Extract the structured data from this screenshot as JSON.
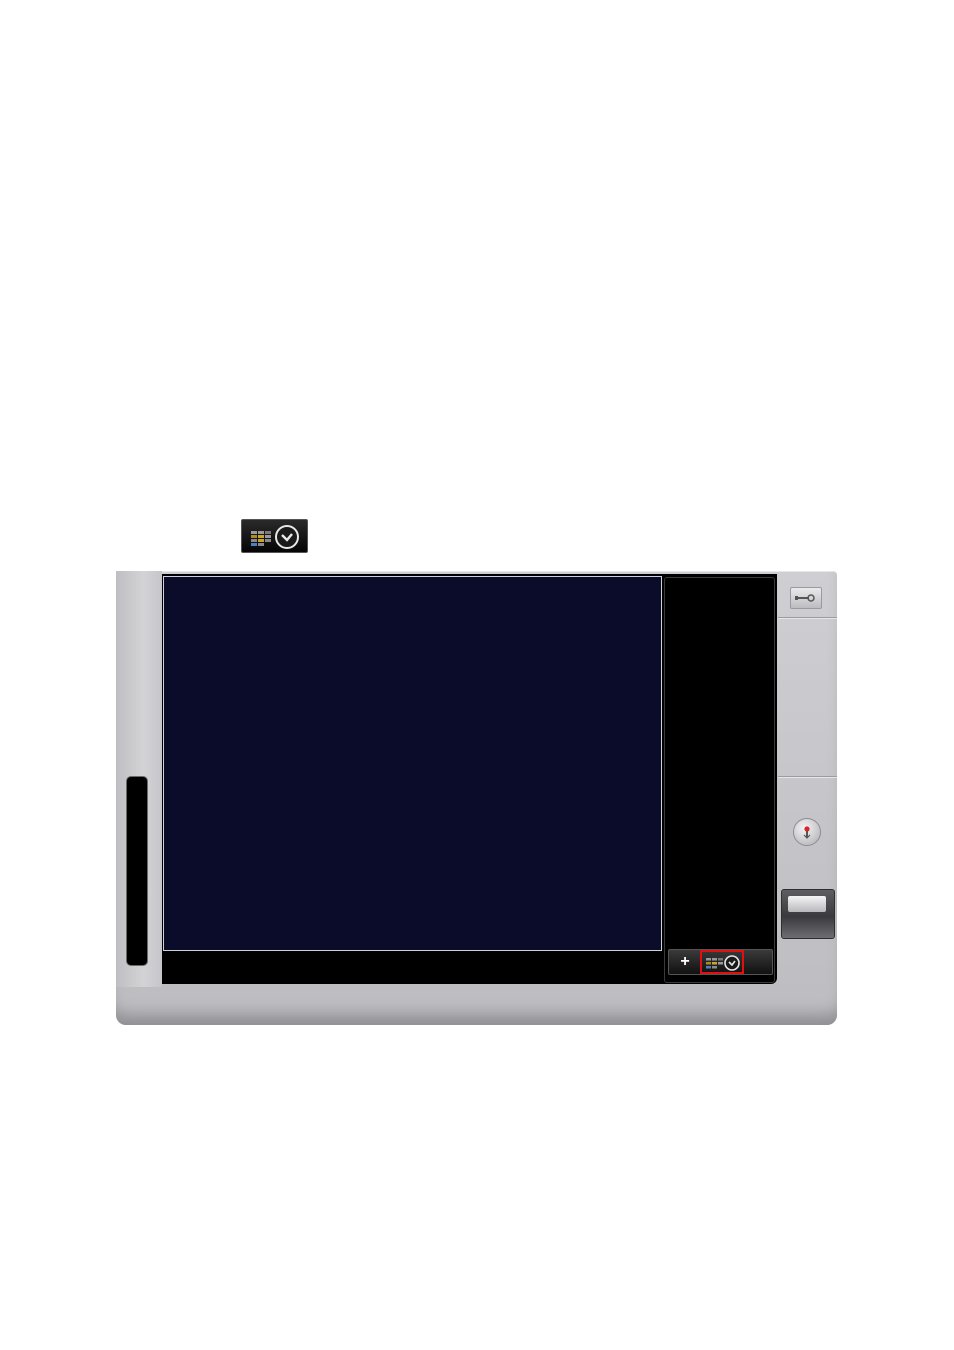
{
  "icons": {
    "schedule": "schedule-clock-icon",
    "plus": "+",
    "wrench": "wrench-icon",
    "record": "record-icon"
  },
  "colors": {
    "video_background": "#0b0c2a",
    "highlight": "#e01010",
    "chrome": "#c6c6ca"
  }
}
